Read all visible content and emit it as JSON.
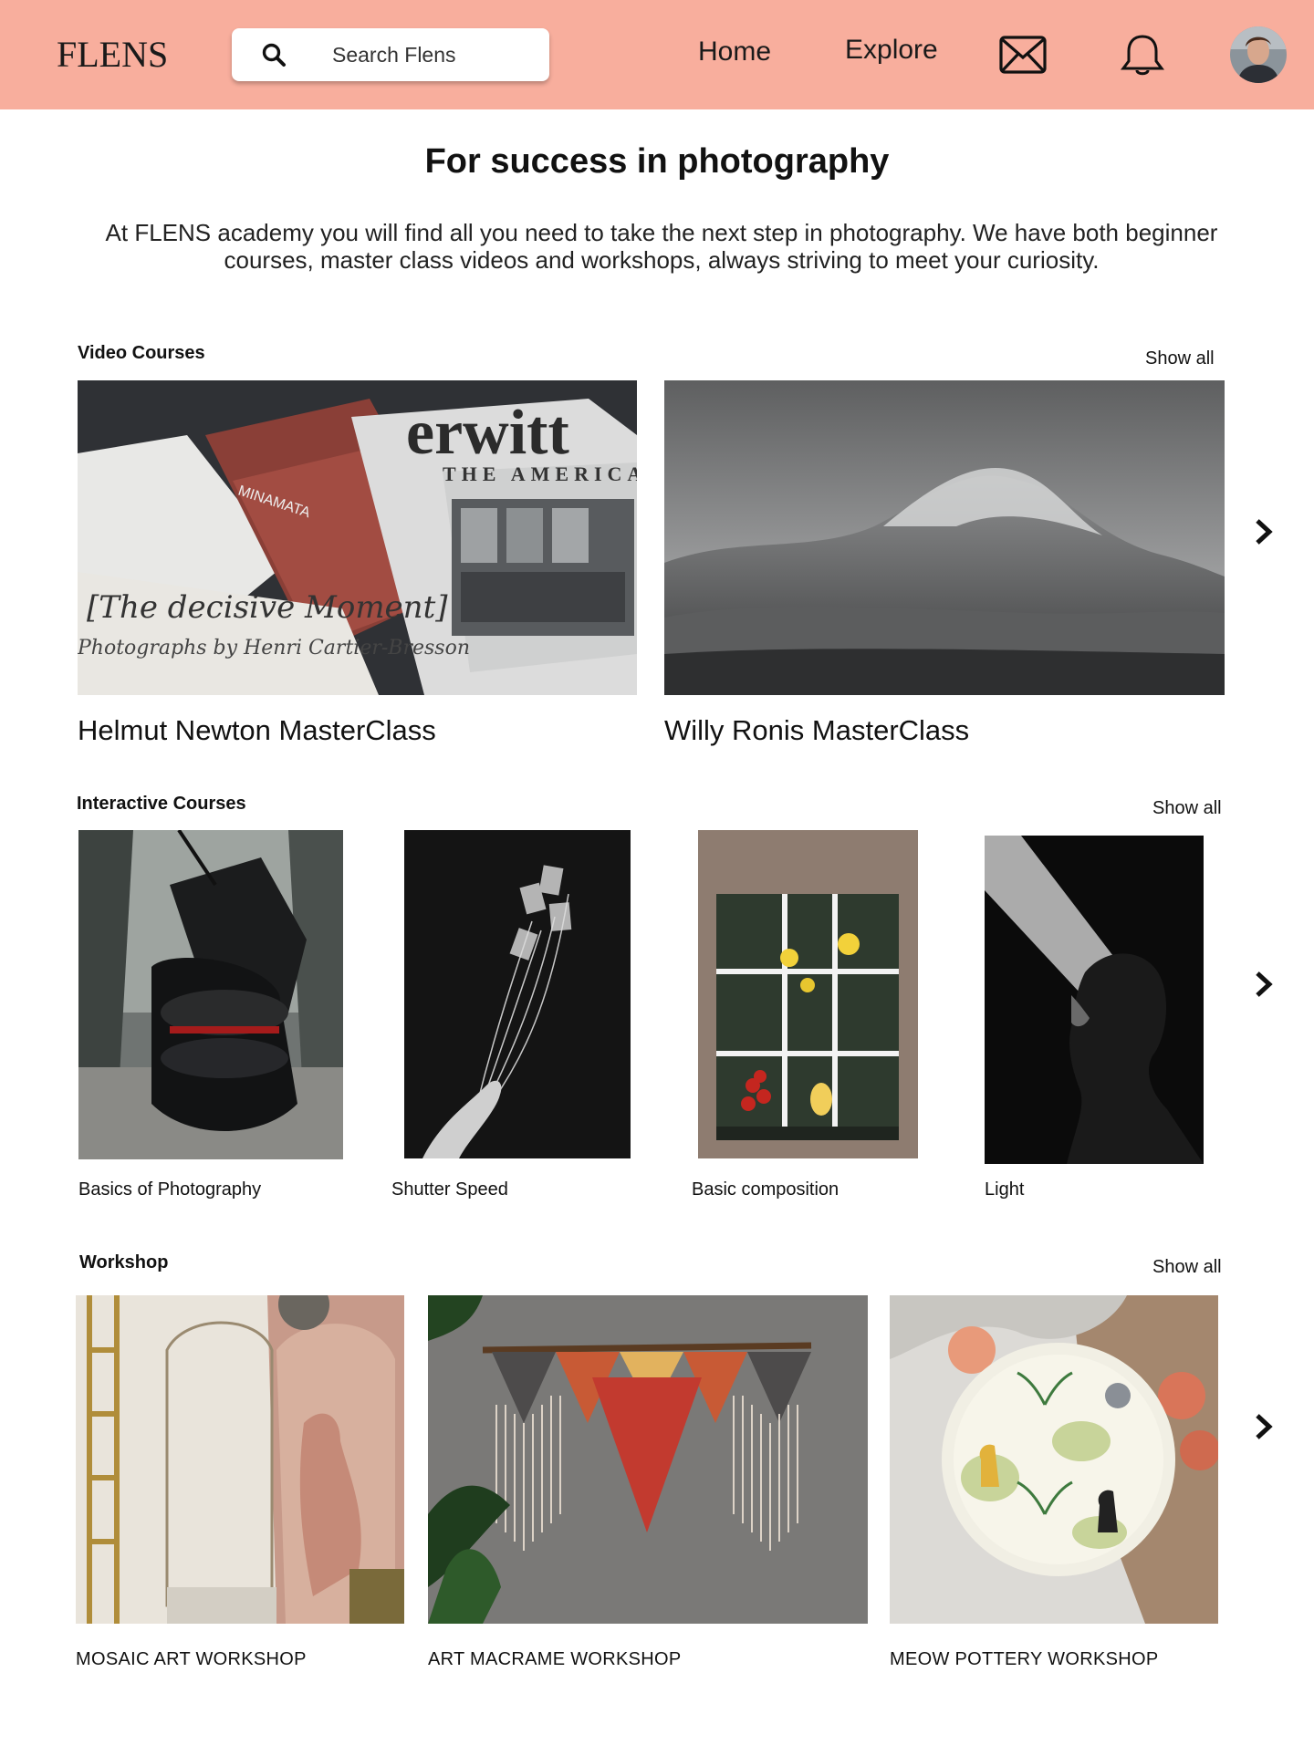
{
  "header": {
    "logo": "FLENS",
    "search_placeholder": "Search Flens",
    "nav": {
      "home": "Home",
      "explore": "Explore"
    },
    "icons": {
      "search": "search-icon",
      "mail": "mail-icon",
      "bell": "bell-icon"
    },
    "background_color": "#f8ae9d"
  },
  "hero": {
    "title": "For success in photography",
    "text": "At FLENS academy you will find all you need to take the next step in photography. We have both beginner courses, master class videos and workshops, always striving to meet your curiosity."
  },
  "video_courses": {
    "title": "Video Courses",
    "show_all": "Show all",
    "items": [
      {
        "title": "Helmut Newton MasterClass"
      },
      {
        "title": "Willy Ronis MasterClass"
      }
    ]
  },
  "interactive_courses": {
    "title": "Interactive Courses",
    "show_all": "Show all",
    "items": [
      {
        "title": "Basics of Photography"
      },
      {
        "title": "Shutter Speed"
      },
      {
        "title": "Basic composition"
      },
      {
        "title": "Light"
      }
    ]
  },
  "workshop": {
    "title": "Workshop",
    "show_all": "Show all",
    "items": [
      {
        "title": "MOSAIC ART WORKSHOP"
      },
      {
        "title": "ART MACRAME WORKSHOP"
      },
      {
        "title": "MEOW POTTERY WORKSHOP"
      }
    ]
  }
}
